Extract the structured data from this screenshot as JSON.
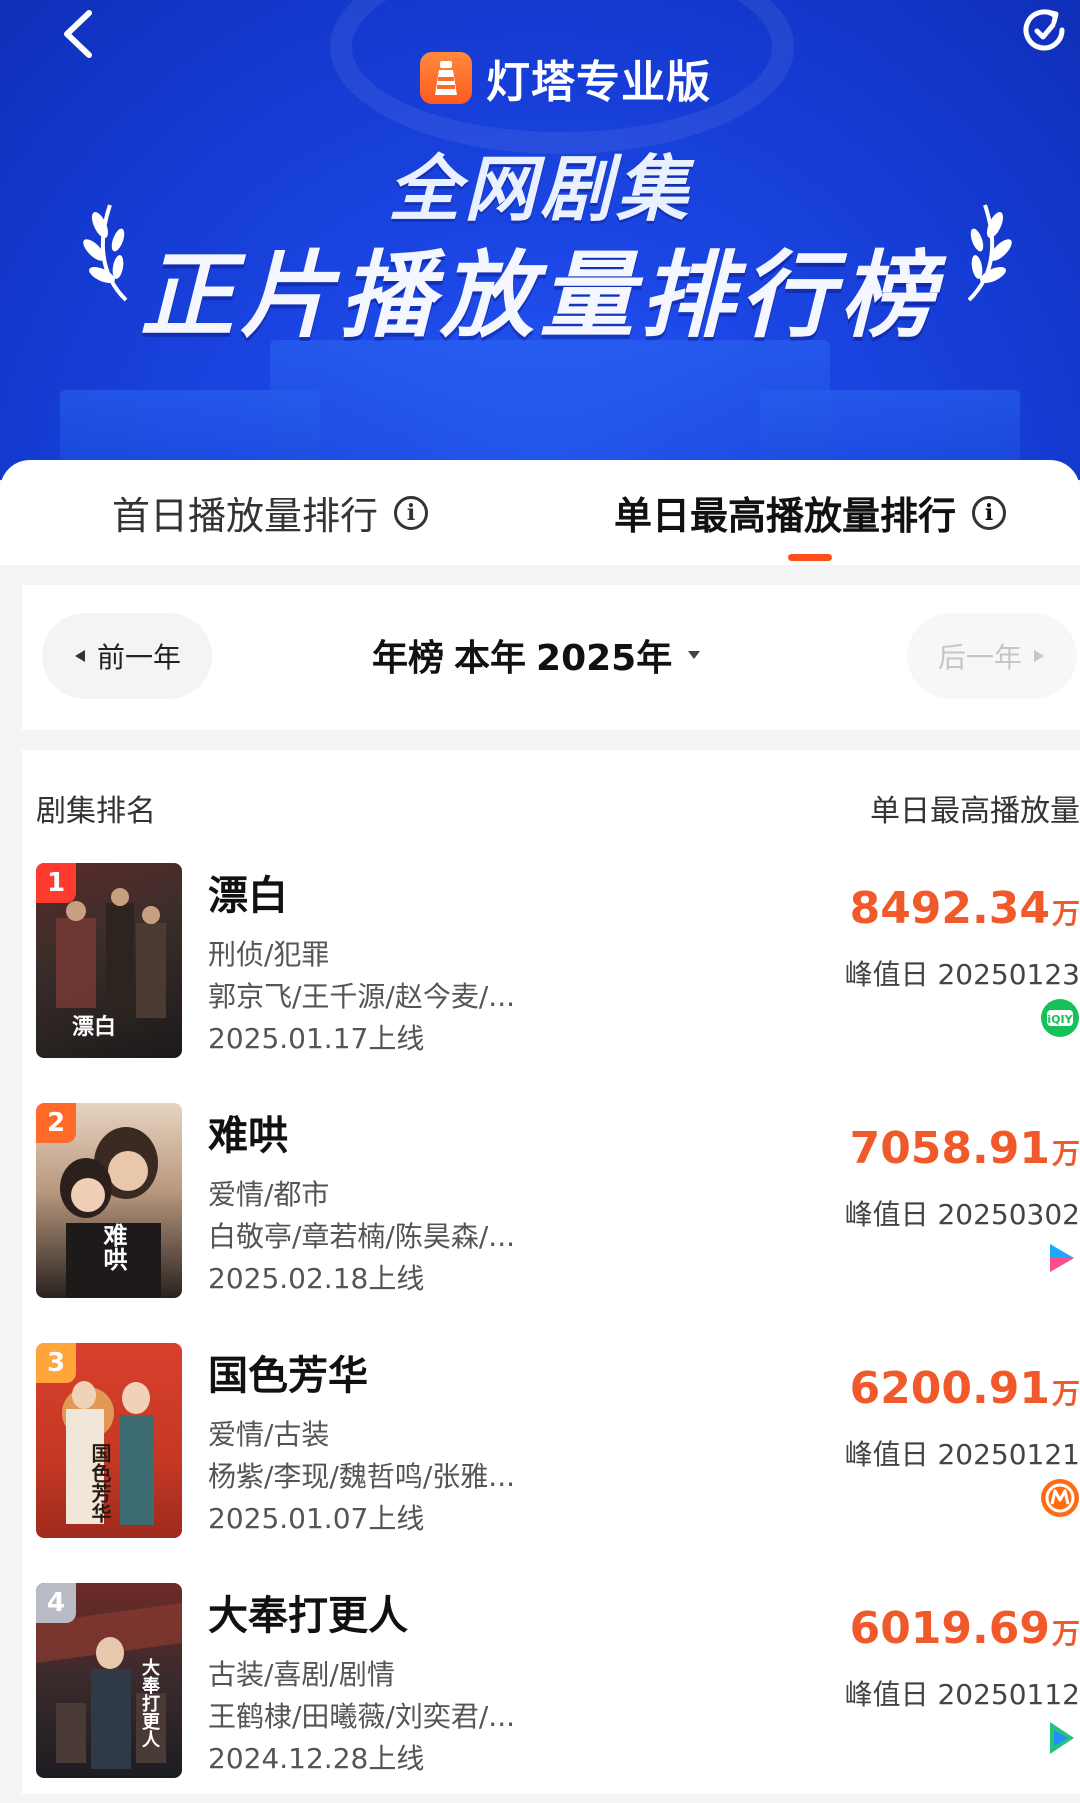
{
  "header": {
    "brand": "灯塔专业版",
    "subtitle": "全网剧集",
    "title": "正片播放量排行榜"
  },
  "tabs": [
    {
      "label": "首日播放量排行",
      "active": false
    },
    {
      "label": "单日最高播放量排行",
      "active": true
    }
  ],
  "year_selector": {
    "prev": "前一年",
    "board": "年榜",
    "period": "本年",
    "year": "2025年",
    "next": "后一年"
  },
  "list": {
    "col_left": "剧集排名",
    "col_right": "单日最高播放量",
    "rows": [
      {
        "rank": "1",
        "title": "漂白",
        "genre": "刑侦/犯罪",
        "cast": "郭京飞/王千源/赵今麦/...",
        "date": "2025.01.17上线",
        "value": "8492.34",
        "unit": "万",
        "peak": "峰值日 20250123",
        "platform_icon": "iqiyi-icon",
        "poster_text": "漂白",
        "rank_color": "#ff3b30"
      },
      {
        "rank": "2",
        "title": "难哄",
        "genre": "爱情/都市",
        "cast": "白敬亭/章若楠/陈昊森/...",
        "date": "2025.02.18上线",
        "value": "7058.91",
        "unit": "万",
        "peak": "峰值日 20250302",
        "platform_icon": "youku-icon",
        "poster_text": "难哄",
        "rank_color": "#ff6a2a"
      },
      {
        "rank": "3",
        "title": "国色芳华",
        "genre": "爱情/古装",
        "cast": "杨紫/李现/魏哲鸣/张雅...",
        "date": "2025.01.07上线",
        "value": "6200.91",
        "unit": "万",
        "peak": "峰值日 20250121",
        "platform_icon": "mgtv-icon",
        "poster_text": "国色芳华",
        "rank_color": "#ffa53a"
      },
      {
        "rank": "4",
        "title": "大奉打更人",
        "genre": "古装/喜剧/剧情",
        "cast": "王鹤棣/田曦薇/刘奕君/...",
        "date": "2024.12.28上线",
        "value": "6019.69",
        "unit": "万",
        "peak": "峰值日 20250112",
        "platform_icon": "tencent-video-icon",
        "poster_text": "大奉打更人",
        "rank_color": "#b9bcc4"
      }
    ]
  }
}
